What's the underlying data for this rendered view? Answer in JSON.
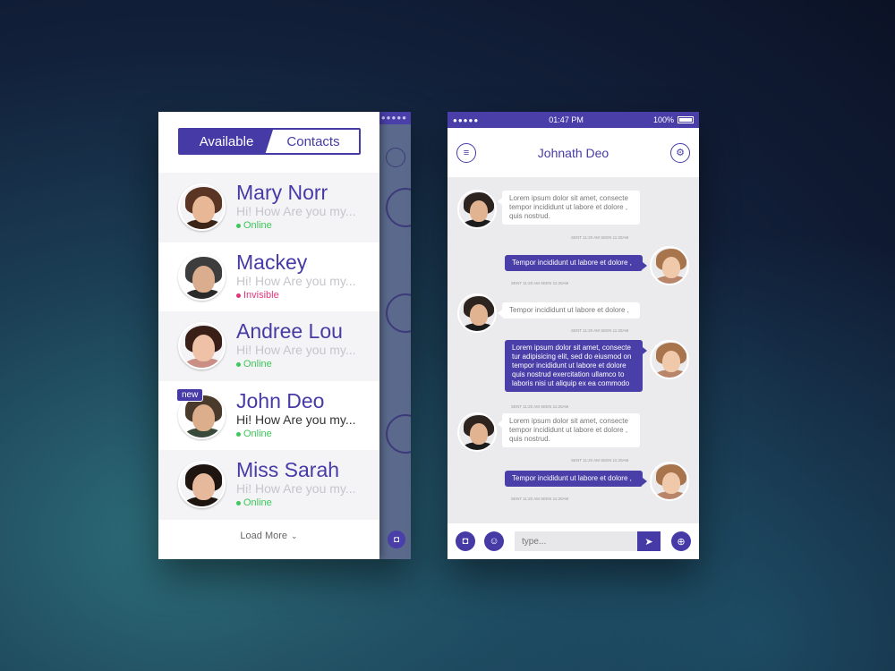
{
  "segmented": {
    "available_label": "Available",
    "contacts_label": "Contacts"
  },
  "contacts": [
    {
      "name": "Mary Norr",
      "message": "Hi! How Are you my...",
      "status": "Online"
    },
    {
      "name": "Mackey",
      "message": "Hi! How Are you my...",
      "status": "Invisible"
    },
    {
      "name": "Andree Lou",
      "message": "Hi! How Are you my...",
      "status": "Online"
    },
    {
      "name": "John Deo",
      "message": "Hi! How Are you my...",
      "status": "Online",
      "badge": "new"
    },
    {
      "name": "Miss Sarah",
      "message": "Hi! How Are you my...",
      "status": "Online"
    }
  ],
  "load_more": "Load More",
  "under_screen": {
    "signal": "●●●●●"
  },
  "statusbar": {
    "signal": "●●●●●",
    "time": "01:47 PM",
    "battery": "100%"
  },
  "chat": {
    "title": "Johnath Deo",
    "messages": [
      {
        "dir": "in",
        "text": "Lorem ipsum dolor sit amet, consecte tempor incididunt ut labore et dolore , quis nostrud.",
        "meta": "SENT 11:20 AM   SEEN 11:20AM"
      },
      {
        "dir": "out",
        "text": "Tempor incididunt ut labore et dolore ,",
        "meta": "SENT 11:20 AM   SEEN 11:20AM"
      },
      {
        "dir": "in",
        "text": "Tempor incididunt ut labore et dolore ,",
        "meta": "SENT 11:20 AM   SEEN 11:20AM"
      },
      {
        "dir": "out",
        "text": "Lorem ipsum dolor sit amet, consecte tur adipisicing elit, sed do eiusmod on tempor incididunt ut labore et dolore quis nostrud exercitation ullamco to laboris nisi ut aliquip ex ea commodo",
        "meta": "SENT 11:20 AM   SEEN 11:20AM"
      },
      {
        "dir": "in",
        "text": "Lorem ipsum dolor sit amet, consecte tempor incididunt ut labore et dolore , quis nostrud.",
        "meta": "SENT 11:20 AM   SEEN 11:20AM"
      },
      {
        "dir": "out",
        "text": "Tempor incididunt ut labore et dolore ,",
        "meta": "SENT 11:20 AM   SEEN 11:20AM"
      }
    ],
    "input_placeholder": "type..."
  },
  "colors": {
    "brand": "#463ba6",
    "online": "#3cc85a",
    "invisible": "#e0357a"
  }
}
